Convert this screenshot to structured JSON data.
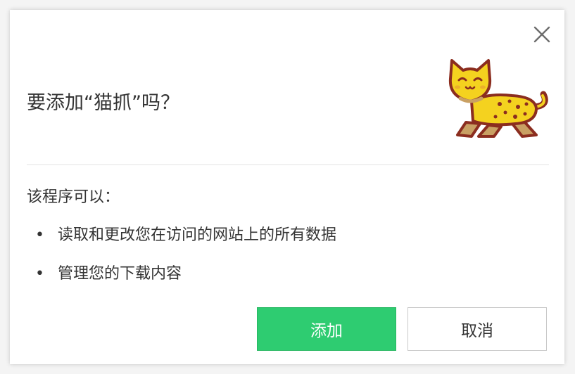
{
  "dialog": {
    "title": "要添加“猫抓”吗？",
    "permissions_heading": "该程序可以：",
    "permissions": [
      "读取和更改您在访问的网站上的所有数据",
      "管理您的下载内容"
    ],
    "bullet": "•",
    "add_label": "添加",
    "cancel_label": "取消",
    "close_icon": "close-icon",
    "mascot_icon": "cat-mascot-icon"
  },
  "colors": {
    "primary_button": "#2ecc71",
    "mascot_fill": "#f4d21f",
    "mascot_outline": "#8b2d1f"
  }
}
